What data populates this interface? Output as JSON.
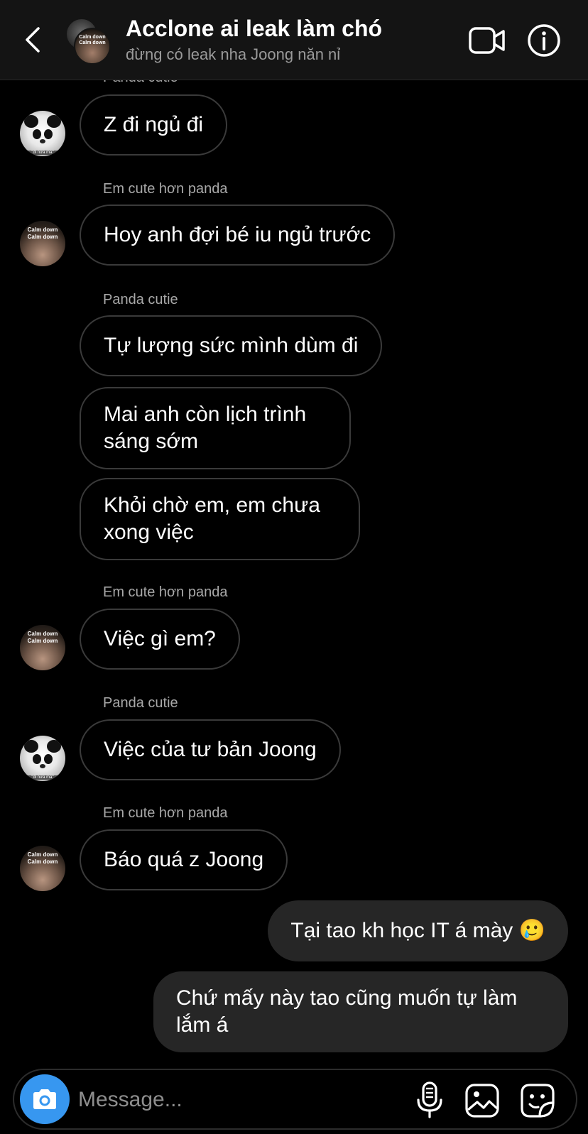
{
  "header": {
    "title": "Acclone ai leak làm chó",
    "subtitle": "đừng có leak nha Joong năn nỉ",
    "avatar_caption": "Calm down\nCalm down"
  },
  "messages": {
    "partial_name": "Panda cutie",
    "m1": "Z đi ngủ đi",
    "n2": "Em cute hơn panda",
    "m2": "Hoy anh đợi bé iu ngủ trước",
    "n3": "Panda cutie",
    "m3": "Tự lượng sức mình dùm đi",
    "m4": "Mai anh còn lịch trình sáng sớm",
    "m5": "Khỏi chờ em, em chưa xong việc",
    "n4": "Em cute hơn panda",
    "m6": "Việc gì em?",
    "n5": "Panda cutie",
    "m7": "Việc của tư bản Joong",
    "n6": "Em cute hơn panda",
    "m8": "Báo quá z Joong",
    "o1": "Tại tao kh học IT á mày 🥲",
    "o2": "Chứ mấy này tao cũng muốn tự làm lắm á"
  },
  "avatars": {
    "panda_caption": "\"đi nữa mà\"",
    "person_caption": "Calm down\nCalm down"
  },
  "composer": {
    "placeholder": "Message..."
  },
  "icons": {
    "back": "chevron-left-icon",
    "video": "video-camera-icon",
    "info": "info-icon",
    "camera": "camera-icon",
    "mic": "microphone-icon",
    "gallery": "image-icon",
    "sticker": "sticker-icon"
  },
  "colors": {
    "accent": "#3797f0",
    "outgoing_bubble": "#262626",
    "header_bg": "#141414"
  }
}
